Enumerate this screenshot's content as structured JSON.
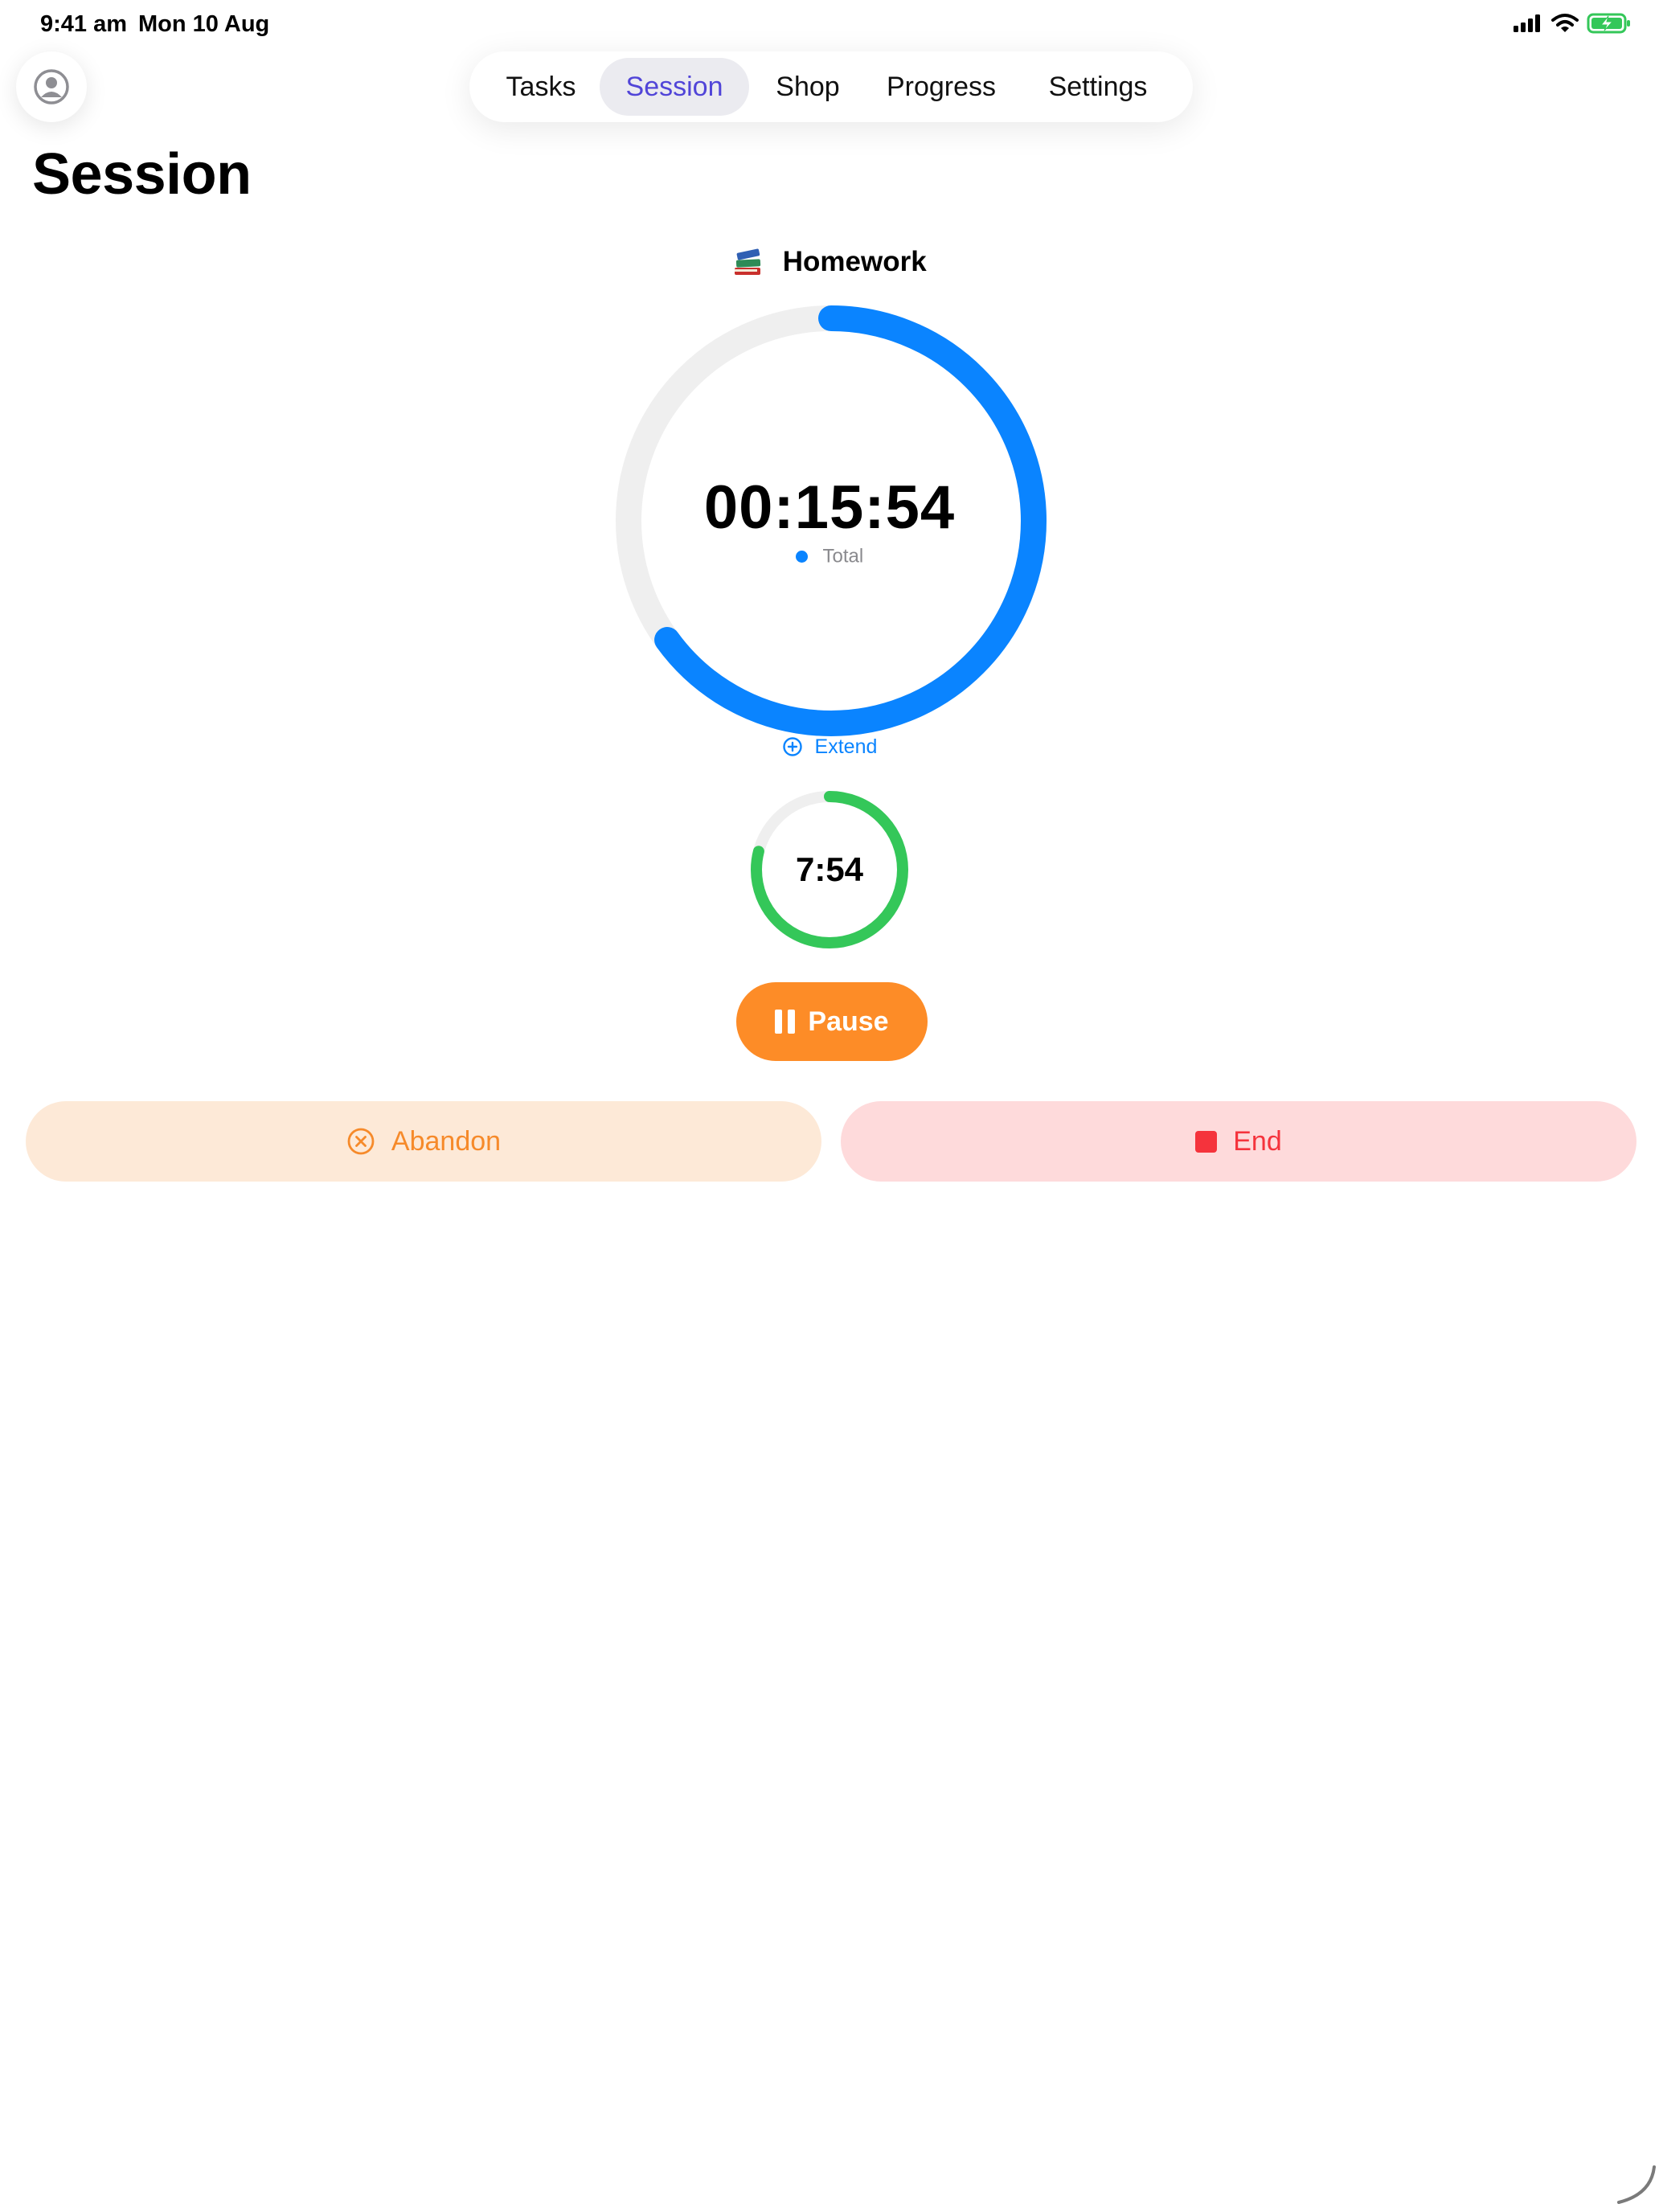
{
  "status_bar": {
    "time": "9:41 am",
    "date": "Mon 10 Aug",
    "battery_color": "#34c759"
  },
  "nav": {
    "tabs": [
      {
        "label": "Tasks",
        "active": false
      },
      {
        "label": "Session",
        "active": true
      },
      {
        "label": "Shop",
        "active": false
      },
      {
        "label": "Progress",
        "active": false
      },
      {
        "label": "Settings",
        "active": false
      }
    ]
  },
  "page": {
    "title": "Session"
  },
  "session": {
    "task_emoji": "books-icon",
    "task_name": "Homework",
    "total_timer": "00:15:54",
    "total_progress": 0.65,
    "total_color": "#0a84ff",
    "legend_label": "Total",
    "extend_label": "Extend",
    "segment_timer": "7:54",
    "segment_progress": 0.79,
    "segment_color": "#34c759"
  },
  "actions": {
    "pause_label": "Pause",
    "abandon_label": "Abandon",
    "end_label": "End",
    "pause_color": "#fd8c27",
    "abandon_color": "#f68a2a",
    "end_color": "#f5333c"
  }
}
